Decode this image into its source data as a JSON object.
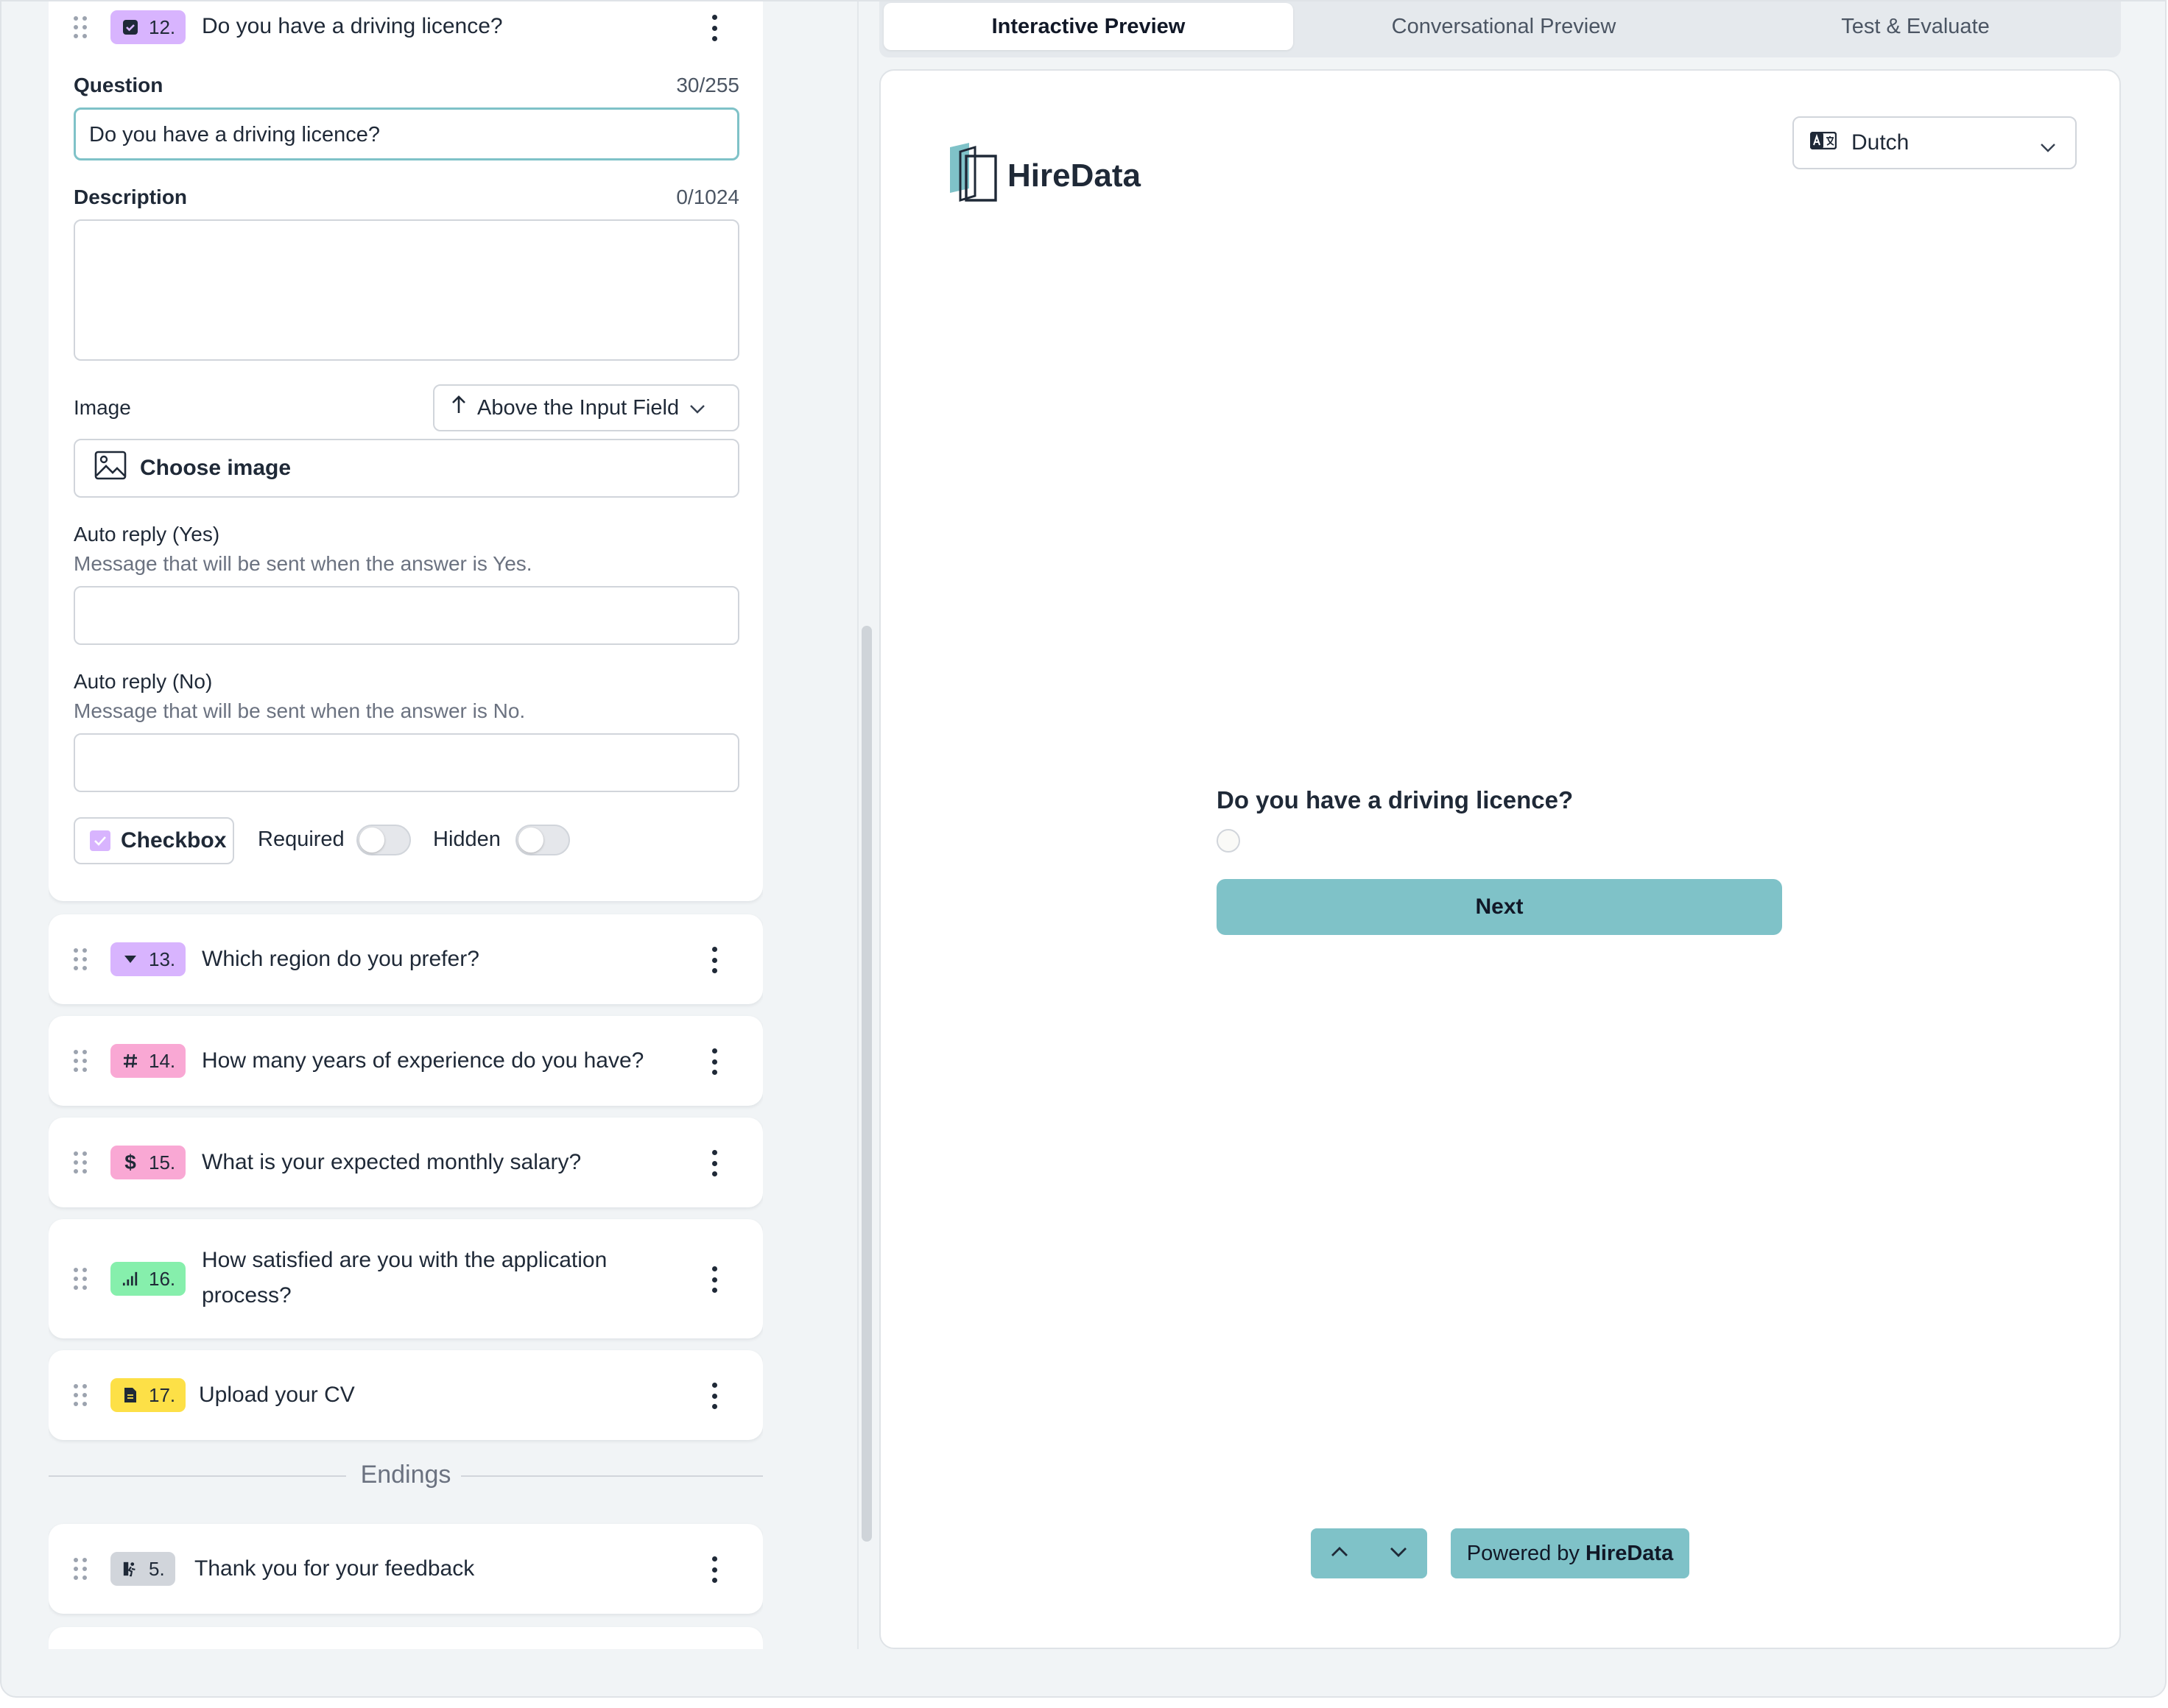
{
  "questions_panel": {
    "active_question": {
      "number": "12.",
      "title": "Do you have a driving licence?",
      "question_label": "Question",
      "question_count": "30/255",
      "question_value": "Do you have a driving licence?",
      "description_label": "Description",
      "description_count": "0/1024",
      "description_value": "",
      "image_label": "Image",
      "image_position": "Above the Input Field",
      "choose_image_label": "Choose image",
      "auto_reply_yes_label": "Auto reply (Yes)",
      "auto_reply_yes_help": "Message that will be sent when the answer is Yes.",
      "auto_reply_yes_value": "",
      "auto_reply_no_label": "Auto reply (No)",
      "auto_reply_no_help": "Message that will be sent when the answer is No.",
      "auto_reply_no_value": "",
      "type_label": "Checkbox",
      "required_label": "Required",
      "required_on": false,
      "hidden_label": "Hidden",
      "hidden_on": false,
      "badge_color": "#d8b4fe"
    },
    "questions": [
      {
        "number": "13.",
        "title": "Which region do you prefer?",
        "icon": "dropdown-icon",
        "badge_color": "#d8b4fe"
      },
      {
        "number": "14.",
        "title": "How many years of experience do you have?",
        "icon": "hash-icon",
        "badge_color": "#f9a8d4"
      },
      {
        "number": "15.",
        "title": "What is your expected monthly salary?",
        "icon": "dollar-icon",
        "badge_color": "#f9a8d4"
      },
      {
        "number": "16.",
        "title_line1": "How satisfied are you with the application",
        "title_line2": "process?",
        "icon": "rating-bars-icon",
        "badge_color": "#86efac"
      },
      {
        "number": "17.",
        "title": "Upload your CV",
        "icon": "file-icon",
        "badge_color": "#fde047"
      }
    ],
    "endings_label": "Endings",
    "endings": [
      {
        "number": "5.",
        "title": "Thank you for your feedback",
        "icon": "exit-icon",
        "badge_color": "#d1d5db"
      }
    ]
  },
  "preview": {
    "tabs": [
      {
        "label": "Interactive Preview",
        "active": true
      },
      {
        "label": "Conversational Preview",
        "active": false
      },
      {
        "label": "Test & Evaluate",
        "active": false
      }
    ],
    "brand_name": "HireData",
    "language": "Dutch",
    "question": "Do you have a driving licence?",
    "next_label": "Next",
    "powered_prefix": "Powered by",
    "powered_brand": "HireData",
    "accent_color": "#7fc2c8"
  }
}
